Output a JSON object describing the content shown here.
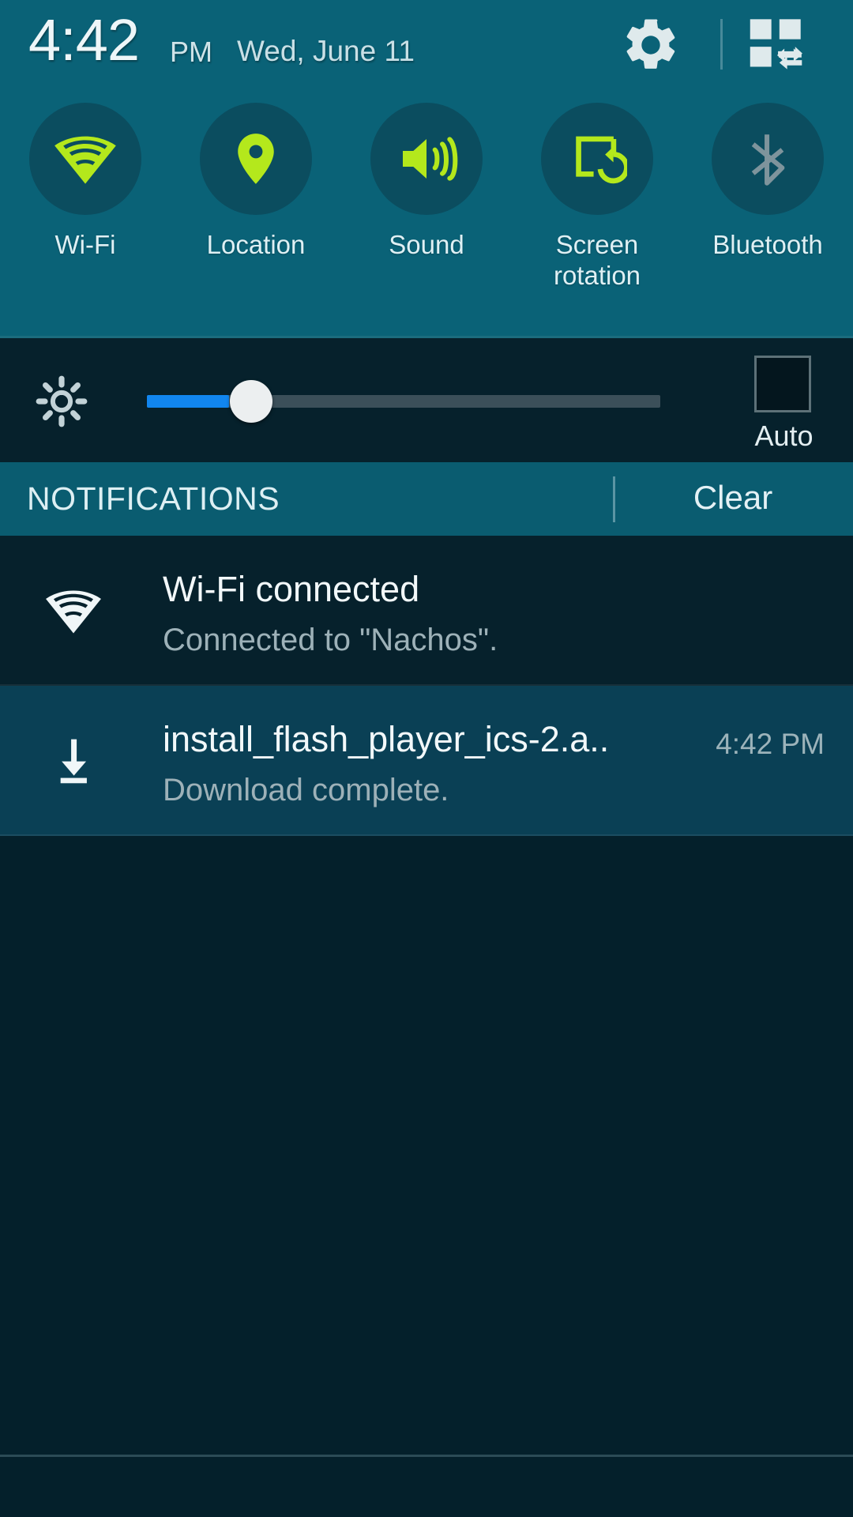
{
  "statusbar": {
    "time": "4:42",
    "ampm": "PM",
    "date": "Wed, June 11",
    "settings_icon": "gear-icon",
    "quick_settings_icon": "quick-settings-grid-icon"
  },
  "quick_toggles": [
    {
      "label": "Wi-Fi",
      "icon": "wifi-icon",
      "state": "on",
      "color": "#b4e81c"
    },
    {
      "label": "Location",
      "icon": "location-pin-icon",
      "state": "on",
      "color": "#b4e81c"
    },
    {
      "label": "Sound",
      "icon": "speaker-sound-icon",
      "state": "on",
      "color": "#b4e81c"
    },
    {
      "label": "Screen\nrotation",
      "icon": "screen-rotation-icon",
      "state": "on",
      "color": "#b4e81c"
    },
    {
      "label": "Bluetooth",
      "icon": "bluetooth-icon",
      "state": "off",
      "color": "#7e949c"
    }
  ],
  "quick_toggle_labels": {
    "wifi": "Wi-Fi",
    "location": "Location",
    "sound": "Sound",
    "screen_rotation_line1": "Screen",
    "screen_rotation_line2": "rotation",
    "bluetooth": "Bluetooth"
  },
  "brightness": {
    "icon": "brightness-gear-icon",
    "value_percent": 16,
    "fill_color": "#1186ef",
    "auto_label": "Auto",
    "auto_checked": false
  },
  "notifications_section": {
    "title": "NOTIFICATIONS",
    "clear_label": "Clear"
  },
  "notifications": [
    {
      "icon": "wifi-icon",
      "title": "Wi-Fi connected",
      "body": "Connected to \"Nachos\".",
      "time": "",
      "highlight": false
    },
    {
      "icon": "download-icon",
      "title": "install_flash_player_ics-2.a..",
      "body": "Download complete.",
      "time": "4:42 PM",
      "highlight": true
    }
  ],
  "colors": {
    "header_teal": "#0a6277",
    "toggle_circle": "#0b4d5f",
    "accent_green": "#b4e81c",
    "shade_dark": "#06212c",
    "shade_body": "#04202b",
    "notif_header": "#0a5c70",
    "notif_highlight": "#0a4055"
  }
}
